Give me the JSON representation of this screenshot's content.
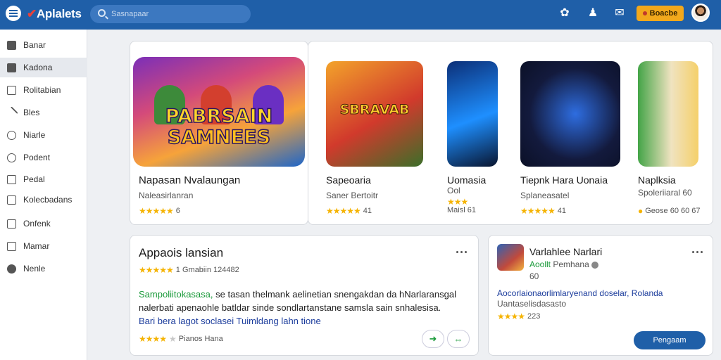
{
  "header": {
    "logo": "Aplalets",
    "search_placeholder": "Sasnapaar",
    "notify_label": "Boacbe",
    "icons": [
      "gift-icon",
      "bell-icon",
      "chat-icon"
    ]
  },
  "sidebar": {
    "items": [
      {
        "label": "Banar",
        "icon": "home-icon"
      },
      {
        "label": "Kadona",
        "icon": "folder-icon"
      },
      {
        "label": "Rolitabian",
        "icon": "grid-icon"
      },
      {
        "label": "Bles",
        "icon": "tools-icon"
      },
      {
        "label": "Niarle",
        "icon": "camera-icon"
      },
      {
        "label": "Podent",
        "icon": "gear-icon"
      },
      {
        "label": "Pedal",
        "icon": "list-icon"
      },
      {
        "label": "Kolecbadans",
        "icon": "bookmark-icon"
      },
      {
        "label": "Onfenk",
        "icon": "share-icon"
      },
      {
        "label": "Mamar",
        "icon": "box-icon"
      },
      {
        "label": "Nenle",
        "icon": "pin-icon"
      }
    ]
  },
  "featured": {
    "banner_line1": "PABRSAIN",
    "banner_line2": "SAMNEES",
    "title": "Napasan Nvalaungan",
    "subtitle": "Naleasirlanran",
    "stars": "★★★★★",
    "rating_text": "6"
  },
  "apps": [
    {
      "banner": "SBRAVAB",
      "title": "Sapeoaria",
      "subtitle": "Saner Bertoitr",
      "stars": "★★★★★",
      "rating_text": "41",
      "colors": [
        "#f3a32b",
        "#d13a2c",
        "#3b6f2a"
      ]
    },
    {
      "title": "Uomasia",
      "subtitle": "Ool",
      "stars": "★★★",
      "rating_text": "Maisl 61",
      "colors": [
        "#0c2f77",
        "#1e8fff",
        "#09142e"
      ]
    },
    {
      "title": "Tiepnk Hara Uonaia",
      "subtitle": "Splaneasatel",
      "stars": "★★★★★",
      "rating_text": "41",
      "colors": [
        "#131a3d",
        "#2e6de0",
        "#0b1026"
      ]
    },
    {
      "title": "Naplksia",
      "subtitle": "Spoleriiaral 60",
      "stars": "●",
      "rating_text": "Geose 60 60 67",
      "colors": [
        "#f5d06a",
        "#43a447",
        "#f0e3c0"
      ]
    }
  ],
  "review": {
    "title": "Appaois lansian",
    "stars": "★★★★★",
    "rating_meta": "1 Gmabiin 124482",
    "body_green": "Sampoliitokasasa,",
    "body_rest": "se tasan thelmank aelinetian snengakdan da hNarlaransgal nalerbati apenaohle batldar sinde sondlartanstane samsla sain snhalesisa.",
    "body_link": "Bari bera lagot soclasei Tuimldang lahn tione",
    "footer_stars": "★★★★",
    "footer_star_empty": "★",
    "footer_text": "Pianos Hana"
  },
  "side_card": {
    "title": "Varlahlee Narlari",
    "author": "Aoollt",
    "author_meta": "Pemhana",
    "meta_line": "60",
    "link_text": "Aocorlaionaorlimlaryenand doselar, Rolanda",
    "sub_text": "Uantaselisdasasto",
    "stars": "★★★★",
    "rating_text": "223",
    "button": "Pengaam"
  }
}
